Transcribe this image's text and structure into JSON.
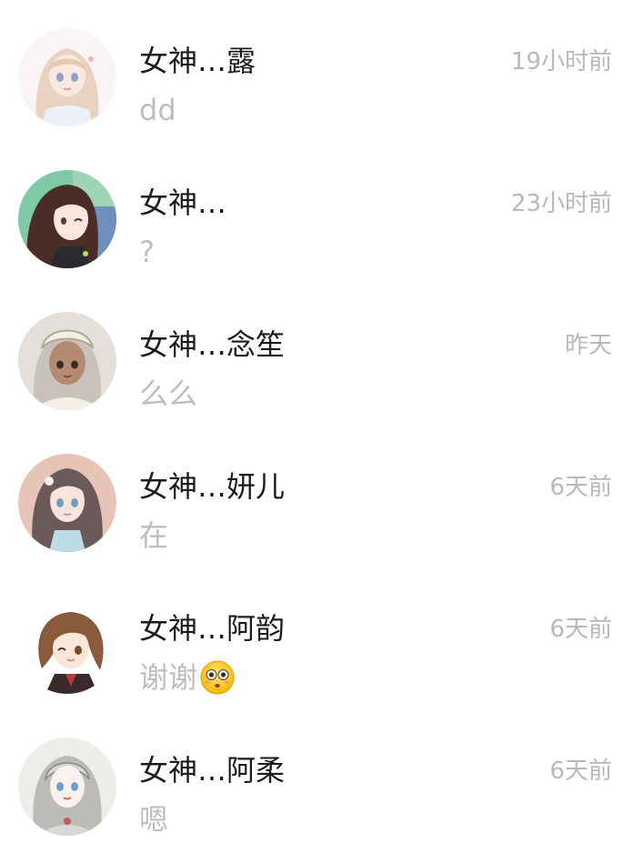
{
  "chats": [
    {
      "name": "女神…露",
      "time": "19小时前",
      "message": "dd",
      "avatar": "anime-girl-blonde-avatar"
    },
    {
      "name": "女神…",
      "time": "23小时前",
      "message": "?",
      "avatar": "anime-girl-brown-hair-avatar"
    },
    {
      "name": "女神…念笙",
      "time": "昨天",
      "message": "么么",
      "avatar": "anime-girl-headdress-avatar"
    },
    {
      "name": "女神…妍儿",
      "time": "6天前",
      "message": "在",
      "avatar": "anime-girl-long-hair-avatar"
    },
    {
      "name": "女神…阿韵",
      "time": "6天前",
      "message": "谢谢",
      "emoji": "flushed-face-emoji",
      "avatar": "anime-girl-short-hair-avatar"
    },
    {
      "name": "女神…阿柔",
      "time": "6天前",
      "message": "嗯",
      "avatar": "anime-girl-sketch-avatar"
    }
  ],
  "colors": {
    "name_text": "#1b1b1b",
    "secondary_text": "#bdbdbd",
    "background": "#ffffff"
  }
}
